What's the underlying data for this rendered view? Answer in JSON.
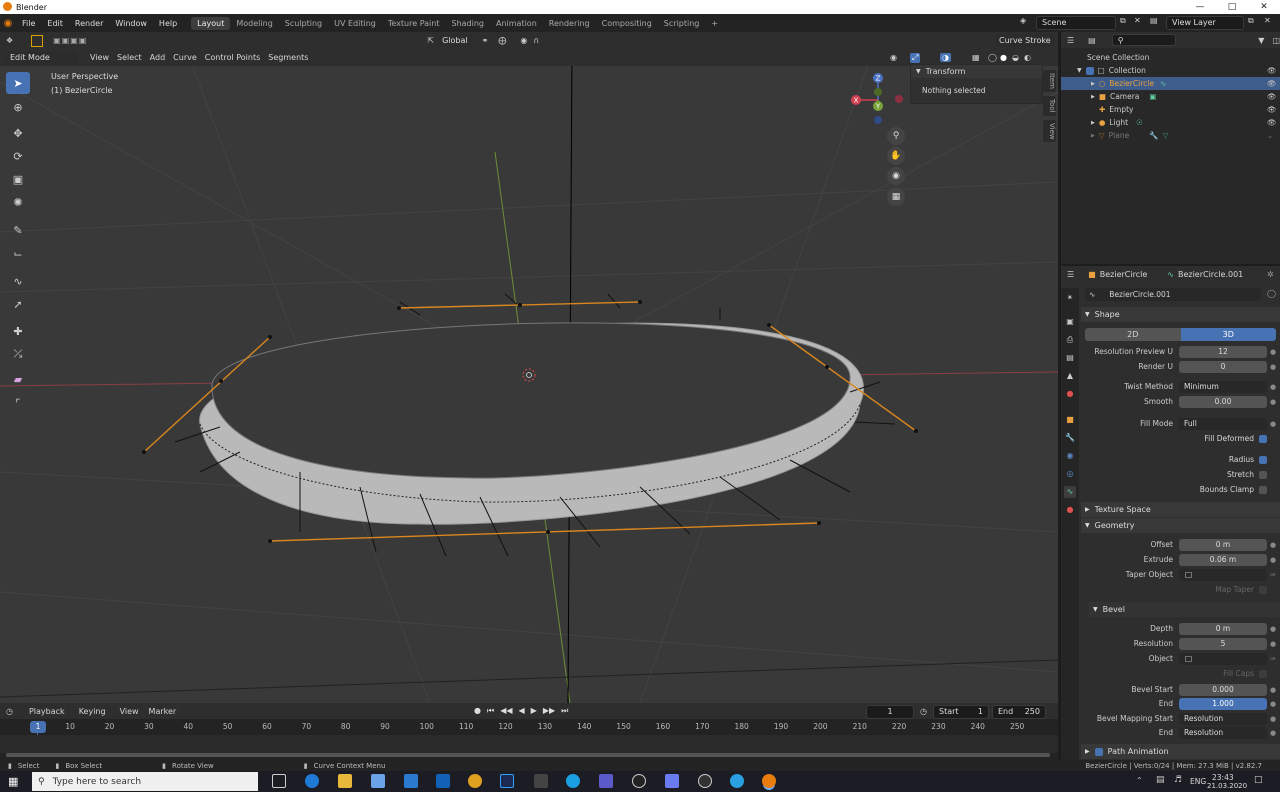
{
  "window": {
    "title": "Blender"
  },
  "menu": [
    "File",
    "Edit",
    "Render",
    "Window",
    "Help"
  ],
  "workspaces": [
    "Layout",
    "Modeling",
    "Sculpting",
    "UV Editing",
    "Texture Paint",
    "Shading",
    "Animation",
    "Rendering",
    "Compositing",
    "Scripting"
  ],
  "active_workspace": "Layout",
  "scene": {
    "name": "Scene"
  },
  "view_layer": {
    "name": "View Layer"
  },
  "viewport": {
    "orientation": "Global",
    "mode": "Edit Mode",
    "menus": [
      "View",
      "Select",
      "Add",
      "Curve",
      "Control Points",
      "Segments"
    ],
    "overlay_text": [
      "User Perspective",
      "(1) BezierCircle"
    ],
    "curve_stroke": "Curve Stroke",
    "gizmo": {
      "x": "X",
      "y": "Y",
      "z": "Z"
    },
    "sidebar_tabs": [
      "Item",
      "Tool",
      "View"
    ],
    "transform": {
      "header": "Transform",
      "text": "Nothing selected"
    }
  },
  "outliner": {
    "root": "Scene Collection",
    "collection": "Collection",
    "items": [
      "BezierCircle",
      "Camera",
      "Empty",
      "Light",
      "Plane"
    ],
    "selected": "BezierCircle"
  },
  "properties": {
    "object": "BezierCircle",
    "data": "BezierCircle.001",
    "datablock": "BezierCircle.001",
    "shape": {
      "header": "Shape",
      "mode_2d": "2D",
      "mode_3d": "3D",
      "rows": [
        {
          "label": "Resolution Preview U",
          "value": "12",
          "kind": "num"
        },
        {
          "label": "Render U",
          "value": "0",
          "kind": "num"
        },
        {
          "label": "Twist Method",
          "value": "Minimum",
          "kind": "dd"
        },
        {
          "label": "Smooth",
          "value": "0.00",
          "kind": "num"
        },
        {
          "label": "Fill Mode",
          "value": "Full",
          "kind": "dd"
        }
      ],
      "checks": [
        {
          "label": "Fill Deformed",
          "on": true
        },
        {
          "label": "Radius",
          "on": true
        },
        {
          "label": "Stretch",
          "on": false
        },
        {
          "label": "Bounds Clamp",
          "on": false
        }
      ]
    },
    "texture_space": "Texture Space",
    "geometry": {
      "header": "Geometry",
      "offset": {
        "label": "Offset",
        "value": "0 m"
      },
      "extrude": {
        "label": "Extrude",
        "value": "0.06 m"
      },
      "taper": {
        "label": "Taper Object"
      },
      "map_taper": "Map Taper"
    },
    "bevel": {
      "header": "Bevel",
      "depth": {
        "label": "Depth",
        "value": "0 m"
      },
      "resolution": {
        "label": "Resolution",
        "value": "5"
      },
      "object": {
        "label": "Object"
      },
      "fill_caps": "Fill Caps",
      "start": {
        "label": "Bevel Start",
        "value": "0.000"
      },
      "end": {
        "label": "End",
        "value": "1.000"
      },
      "mapping_start": {
        "label": "Bevel Mapping Start",
        "value": "Resolution"
      },
      "mapping_end": {
        "label": "End",
        "value": "Resolution"
      }
    },
    "path_animation": "Path Animation"
  },
  "timeline": {
    "menus": [
      "Playback",
      "Keying",
      "View",
      "Marker"
    ],
    "current": "1",
    "start_label": "Start",
    "start": "1",
    "end_label": "End",
    "end": "250",
    "ticks": [
      "1",
      "10",
      "20",
      "30",
      "40",
      "50",
      "60",
      "70",
      "80",
      "90",
      "100",
      "110",
      "120",
      "130",
      "140",
      "150",
      "160",
      "170",
      "180",
      "190",
      "200",
      "210",
      "220",
      "230",
      "240",
      "250"
    ]
  },
  "status": {
    "select": "Select",
    "box_select": "Box Select",
    "rotate": "Rotate View",
    "context": "Curve Context Menu",
    "info": "BezierCircle | Verts:0/24 | Mem: 27.3 MiB | v2.82.7"
  },
  "taskbar": {
    "search": "Type here to search",
    "lang": "ENG",
    "time": "23:43",
    "date": "21.03.2020"
  }
}
